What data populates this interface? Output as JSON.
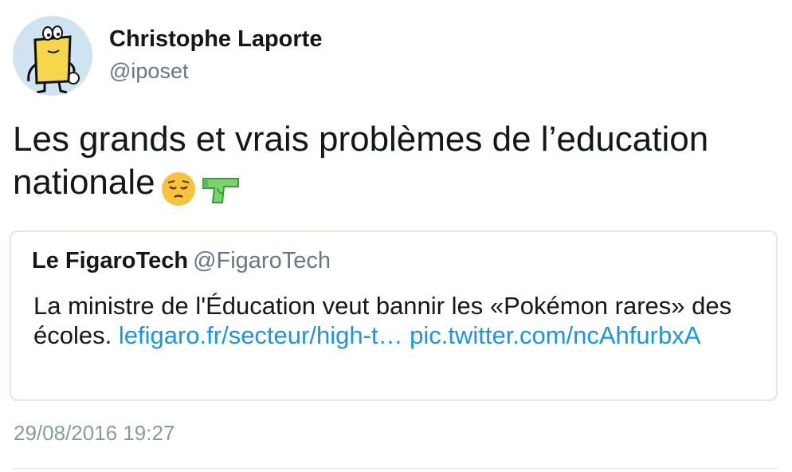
{
  "author": {
    "display_name": "Christophe Laporte",
    "handle": "@iposet",
    "avatar_icon": "cartoon-character-avatar-icon"
  },
  "tweet": {
    "text": "Les grands et vrais problèmes de l’education nationale",
    "emojis": [
      "pensive-face-icon",
      "water-pistol-icon"
    ],
    "timestamp": "29/08/2016 19:27"
  },
  "quoted_tweet": {
    "display_name": "Le FigaroTech",
    "handle": "@FigaroTech",
    "text": "La ministre de l'Éducation veut bannir les «Pokémon rares» des écoles.",
    "link_1": "lefigaro.fr/secteur/high-t…",
    "link_2": "pic.twitter.com/ncAhfurbxA"
  },
  "colors": {
    "link": "#1b95e0",
    "secondary_text": "#657786",
    "border": "#e1e8ed"
  }
}
